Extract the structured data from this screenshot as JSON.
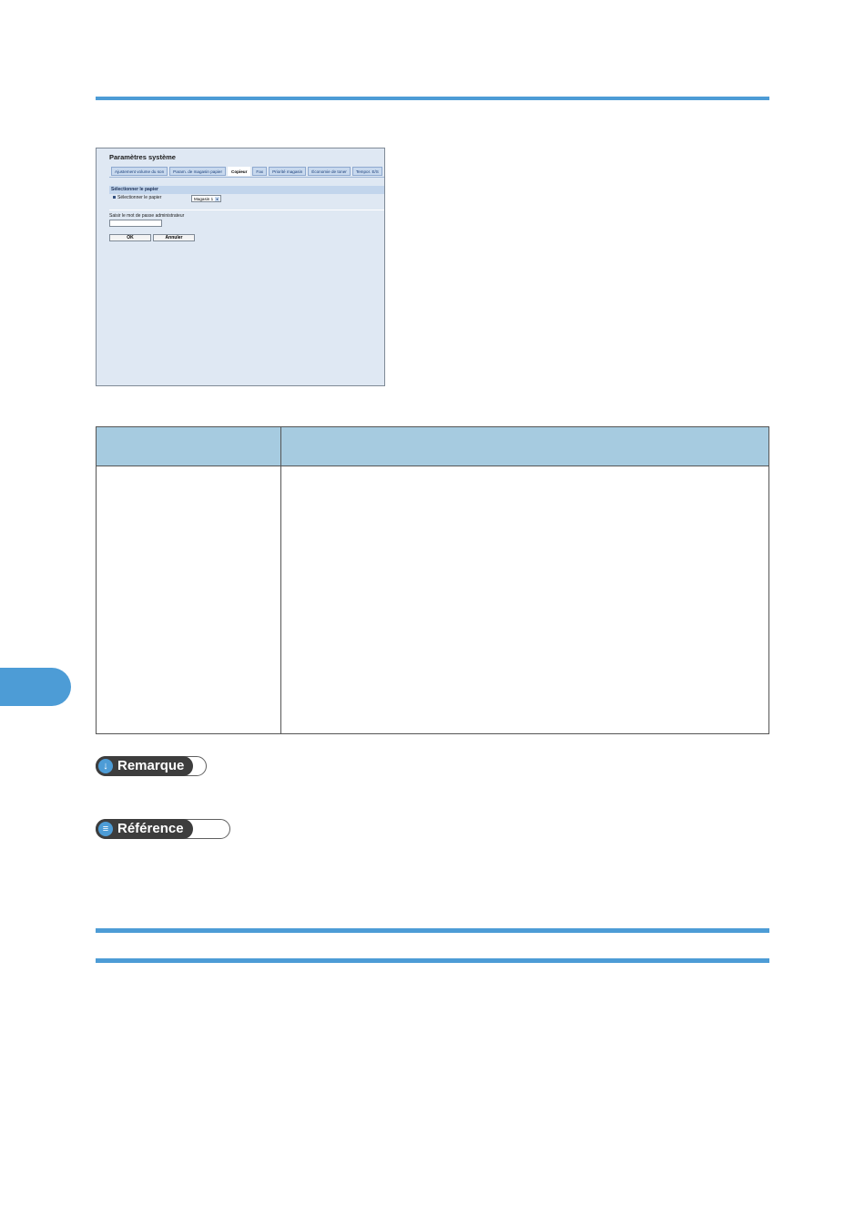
{
  "screenshot": {
    "title": "Paramètres système",
    "tabs": [
      {
        "label": "Ajustement volume du son",
        "active": false
      },
      {
        "label": "Param. de magasin papier",
        "active": false
      },
      {
        "label": "Copieur",
        "active": true
      },
      {
        "label": "Fax",
        "active": false
      },
      {
        "label": "Priorité magasin",
        "active": false
      },
      {
        "label": "Économie de toner",
        "active": false
      },
      {
        "label": "Tempor. E/S",
        "active": false
      }
    ],
    "section_label": "Sélectionner le papier",
    "option_label": "Sélectionner le papier",
    "select_value": "Magasin 1",
    "password_label": "Saisir le mot de passe administrateur",
    "ok_label": "OK",
    "cancel_label": "Annuler"
  },
  "badges": {
    "remarque": "Remarque",
    "reference": "Référence"
  },
  "colors": {
    "accent": "#4d9cd6",
    "table_header": "#a6cbe0"
  }
}
